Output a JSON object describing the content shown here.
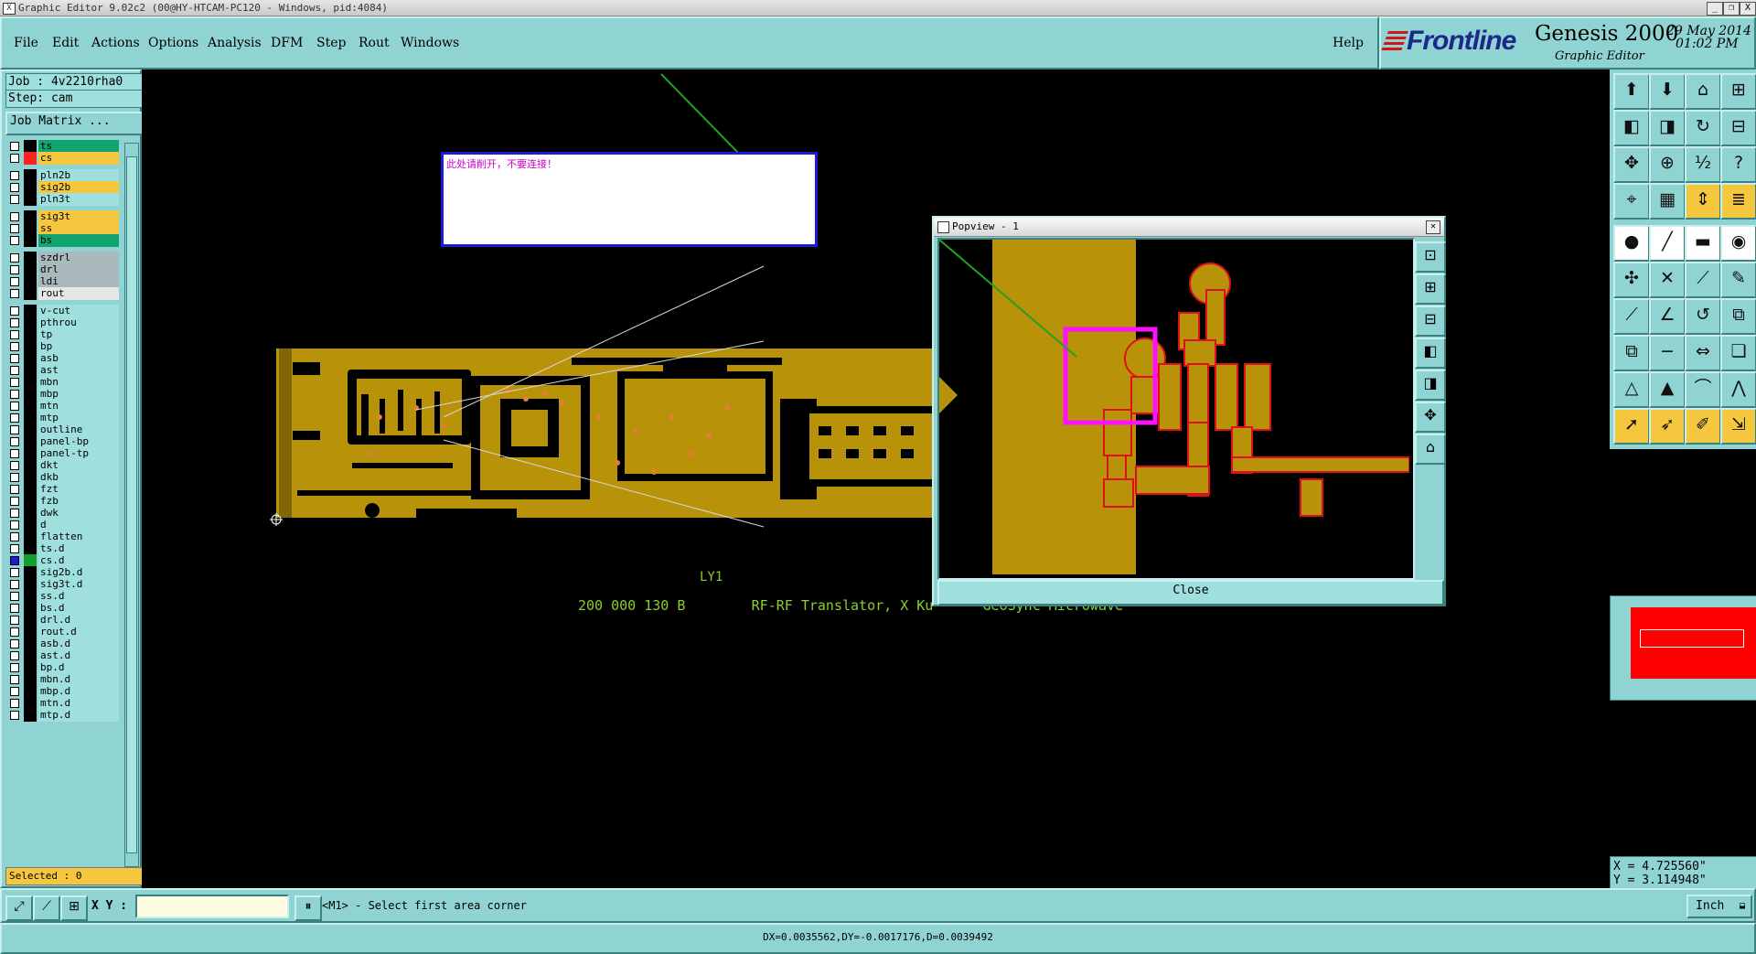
{
  "window": {
    "title": "Graphic Editor 9.02c2 (00@HY-HTCAM-PC120 - Windows, pid:4084)",
    "controls": [
      "_",
      "❐",
      "X"
    ]
  },
  "menu": {
    "items": [
      "File",
      "Edit",
      "Actions",
      "Options",
      "Analysis",
      "DFM",
      "Step",
      "Rout",
      "Windows"
    ],
    "help": "Help"
  },
  "brand": {
    "logo": "Frontline",
    "product": "Genesis 2000",
    "subtitle": "Graphic Editor",
    "date": "29 May 2014",
    "time": "01:02 PM"
  },
  "job": {
    "job_line": "Job : 4v2210rha0",
    "step_line": "Step: cam",
    "matrix_button": "Job Matrix ..."
  },
  "layers": [
    {
      "name": "ts",
      "color": "#12a36e",
      "swatch": "#000000",
      "group": 0
    },
    {
      "name": "cs",
      "color": "#f5c73e",
      "swatch": "#ff2020",
      "group": 0
    },
    {
      "name": "pln2b",
      "color": "#9fe0de",
      "swatch": "#000000",
      "group": 1
    },
    {
      "name": "sig2b",
      "color": "#f5c73e",
      "swatch": "#000000",
      "group": 1
    },
    {
      "name": "pln3t",
      "color": "#9fe0de",
      "swatch": "#000000",
      "group": 1
    },
    {
      "name": "sig3t",
      "color": "#f5c73e",
      "swatch": "#000000",
      "group": 2
    },
    {
      "name": "ss",
      "color": "#f5c73e",
      "swatch": "#000000",
      "group": 2
    },
    {
      "name": "bs",
      "color": "#12a36e",
      "swatch": "#000000",
      "group": 2
    },
    {
      "name": "szdrl",
      "color": "#a9b9bc",
      "swatch": "#000000",
      "group": 3
    },
    {
      "name": "drl",
      "color": "#a9b9bc",
      "swatch": "#000000",
      "group": 3
    },
    {
      "name": "ldi",
      "color": "#a9b9bc",
      "swatch": "#000000",
      "group": 3
    },
    {
      "name": "rout",
      "color": "#e6e6e6",
      "swatch": "#000000",
      "group": 3
    },
    {
      "name": "v-cut",
      "color": "#9fe0de",
      "swatch": "#000000",
      "group": 4
    },
    {
      "name": "pthrou",
      "color": "#9fe0de",
      "swatch": "#000000",
      "group": 4
    },
    {
      "name": "tp",
      "color": "#9fe0de",
      "swatch": "#000000",
      "group": 4
    },
    {
      "name": "bp",
      "color": "#9fe0de",
      "swatch": "#000000",
      "group": 4
    },
    {
      "name": "asb",
      "color": "#9fe0de",
      "swatch": "#000000",
      "group": 4
    },
    {
      "name": "ast",
      "color": "#9fe0de",
      "swatch": "#000000",
      "group": 4
    },
    {
      "name": "mbn",
      "color": "#9fe0de",
      "swatch": "#000000",
      "group": 4
    },
    {
      "name": "mbp",
      "color": "#9fe0de",
      "swatch": "#000000",
      "group": 4
    },
    {
      "name": "mtn",
      "color": "#9fe0de",
      "swatch": "#000000",
      "group": 4
    },
    {
      "name": "mtp",
      "color": "#9fe0de",
      "swatch": "#000000",
      "group": 4
    },
    {
      "name": "outline",
      "color": "#9fe0de",
      "swatch": "#000000",
      "group": 4
    },
    {
      "name": "panel-bp",
      "color": "#9fe0de",
      "swatch": "#000000",
      "group": 4
    },
    {
      "name": "panel-tp",
      "color": "#9fe0de",
      "swatch": "#000000",
      "group": 4
    },
    {
      "name": "dkt",
      "color": "#9fe0de",
      "swatch": "#000000",
      "group": 4
    },
    {
      "name": "dkb",
      "color": "#9fe0de",
      "swatch": "#000000",
      "group": 4
    },
    {
      "name": "fzt",
      "color": "#9fe0de",
      "swatch": "#000000",
      "group": 4
    },
    {
      "name": "fzb",
      "color": "#9fe0de",
      "swatch": "#000000",
      "group": 4
    },
    {
      "name": "dwk",
      "color": "#9fe0de",
      "swatch": "#000000",
      "group": 4
    },
    {
      "name": "d",
      "color": "#9fe0de",
      "swatch": "#000000",
      "group": 4
    },
    {
      "name": "flatten",
      "color": "#9fe0de",
      "swatch": "#000000",
      "group": 4
    },
    {
      "name": "ts.d",
      "color": "#9fe0de",
      "swatch": "#000000",
      "group": 4
    },
    {
      "name": "cs.d",
      "color": "#9fe0de",
      "swatch": "#12a030",
      "group": 4,
      "checked": true
    },
    {
      "name": "sig2b.d",
      "color": "#9fe0de",
      "swatch": "#000000",
      "group": 4
    },
    {
      "name": "sig3t.d",
      "color": "#9fe0de",
      "swatch": "#000000",
      "group": 4
    },
    {
      "name": "ss.d",
      "color": "#9fe0de",
      "swatch": "#000000",
      "group": 4
    },
    {
      "name": "bs.d",
      "color": "#9fe0de",
      "swatch": "#000000",
      "group": 4
    },
    {
      "name": "drl.d",
      "color": "#9fe0de",
      "swatch": "#000000",
      "group": 4
    },
    {
      "name": "rout.d",
      "color": "#9fe0de",
      "swatch": "#000000",
      "group": 4
    },
    {
      "name": "asb.d",
      "color": "#9fe0de",
      "swatch": "#000000",
      "group": 4
    },
    {
      "name": "ast.d",
      "color": "#9fe0de",
      "swatch": "#000000",
      "group": 4
    },
    {
      "name": "bp.d",
      "color": "#9fe0de",
      "swatch": "#000000",
      "group": 4
    },
    {
      "name": "mbn.d",
      "color": "#9fe0de",
      "swatch": "#000000",
      "group": 4
    },
    {
      "name": "mbp.d",
      "color": "#9fe0de",
      "swatch": "#000000",
      "group": 4
    },
    {
      "name": "mtn.d",
      "color": "#9fe0de",
      "swatch": "#000000",
      "group": 4
    },
    {
      "name": "mtp.d",
      "color": "#9fe0de",
      "swatch": "#000000",
      "group": 4
    }
  ],
  "selected_text": "Selected : 0",
  "canvas": {
    "note_text": "此处请削开，不要连接！",
    "board_label": "LY1",
    "silk_text": "200 000 130 B        RF-RF Translator, X Ku      GeoSync Microwave",
    "copper_color": "#b8930a",
    "highlight_color": "#ff10ff"
  },
  "popview": {
    "title": "Popview - 1",
    "close_label": "Close",
    "side_icons": [
      "zoom-fit-icon",
      "zoom-in-icon",
      "zoom-out-icon",
      "pan-left-icon",
      "pan-right-icon",
      "pan-all-icon",
      "home-icon"
    ]
  },
  "toolbox": {
    "icons": [
      "zoom-in-icon",
      "zoom-out-icon",
      "home-icon",
      "window-icon",
      "pan-left-icon",
      "pan-right-icon",
      "redraw-icon",
      "split-icon",
      "fit-icon",
      "center-icon",
      "scale-icon",
      "help-icon",
      "snap-icon",
      "grid-icon",
      "measure-icon",
      "layers-icon",
      "pad-icon",
      "line-icon",
      "slot-icon",
      "circle-icon",
      "net-icon",
      "cross-icon",
      "connect-icon",
      "draw-icon",
      "red-line-icon",
      "angle-icon",
      "arc-icon",
      "feature-icon",
      "copy-icon",
      "minus-icon",
      "move-icon",
      "multi-icon",
      "polygon-icon",
      "triangle-icon",
      "arch-icon",
      "peak-icon",
      "pointer-icon",
      "select-icon",
      "edit-icon",
      "nudge-icon"
    ],
    "coord_x": "X = 4.725560\"",
    "coord_y": "Y = 3.114948\""
  },
  "command": {
    "xy_label": "X Y :",
    "xy_value": "",
    "prompt": "<M1> - Select first area corner",
    "units": "Inch"
  },
  "status": "DX=0.0035562,DY=-0.0017176,D=0.0039492"
}
